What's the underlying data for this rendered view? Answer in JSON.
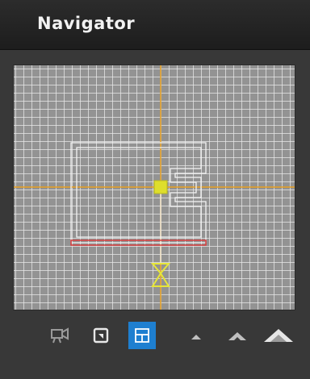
{
  "window": {
    "title": "Navigator"
  },
  "colors": {
    "title_text": "#f2f2f2",
    "grid_background": "#939393",
    "crosshair": "#e8a020",
    "wall_outline": "#f4f4f4",
    "highlight_wall": "#d84040",
    "camera_marker": "#e6e63a",
    "active_button": "#1e7fd0",
    "icon_gray": "#bfbfbf"
  },
  "toolbar": {
    "buttons": [
      {
        "name": "camera-view-button",
        "icon": "video-camera-icon",
        "active": false
      },
      {
        "name": "export-view-button",
        "icon": "square-arrow-icon",
        "active": false
      },
      {
        "name": "plan-view-button",
        "icon": "floor-plan-icon",
        "active": true
      },
      {
        "name": "zoom-small-button",
        "icon": "small-mountain-icon",
        "active": false
      },
      {
        "name": "zoom-medium-button",
        "icon": "medium-mountain-icon",
        "active": false
      },
      {
        "name": "zoom-large-button",
        "icon": "large-mountain-icon",
        "active": false
      }
    ]
  }
}
